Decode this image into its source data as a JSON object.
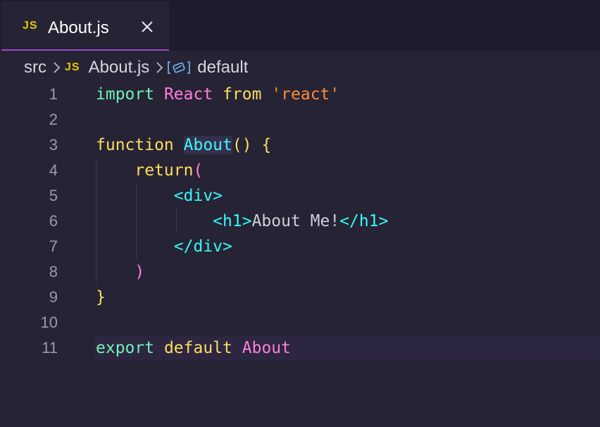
{
  "tab": {
    "badge": "JS",
    "title": "About.js"
  },
  "breadcrumb": {
    "folder": "src",
    "file_badge": "JS",
    "file": "About.js",
    "symbol": "default"
  },
  "code": {
    "line_numbers": [
      "1",
      "2",
      "3",
      "4",
      "5",
      "6",
      "7",
      "8",
      "9",
      "10",
      "11"
    ],
    "l1": {
      "kw": "import",
      "name": "React",
      "from": "from",
      "str": "'react'"
    },
    "l3": {
      "kw": "function",
      "name": "About",
      "paren": "()",
      "brace": "{"
    },
    "l4": {
      "kw": "return",
      "paren": "("
    },
    "l5": {
      "tag": "<div>"
    },
    "l6": {
      "open": "<h1>",
      "text": "About Me!",
      "close": "</h1>"
    },
    "l7": {
      "tag": "</div>"
    },
    "l8": {
      "paren": ")"
    },
    "l9": {
      "brace": "}"
    },
    "l11": {
      "kw": "export",
      "kw2": "default",
      "name": "About"
    }
  },
  "colors": {
    "background": "#262335",
    "keyword": "#72f1b8",
    "identifier": "#ff7edb",
    "bracket": "#fede5d",
    "string": "#ff8b39",
    "jsx_tag": "#36f9f6",
    "tab_accent": "#9b47c9"
  },
  "icons": {
    "tab_close": "close-icon",
    "breadcrumb_separator": "chevron-right-icon",
    "symbol": "symbol-namespace-icon"
  }
}
